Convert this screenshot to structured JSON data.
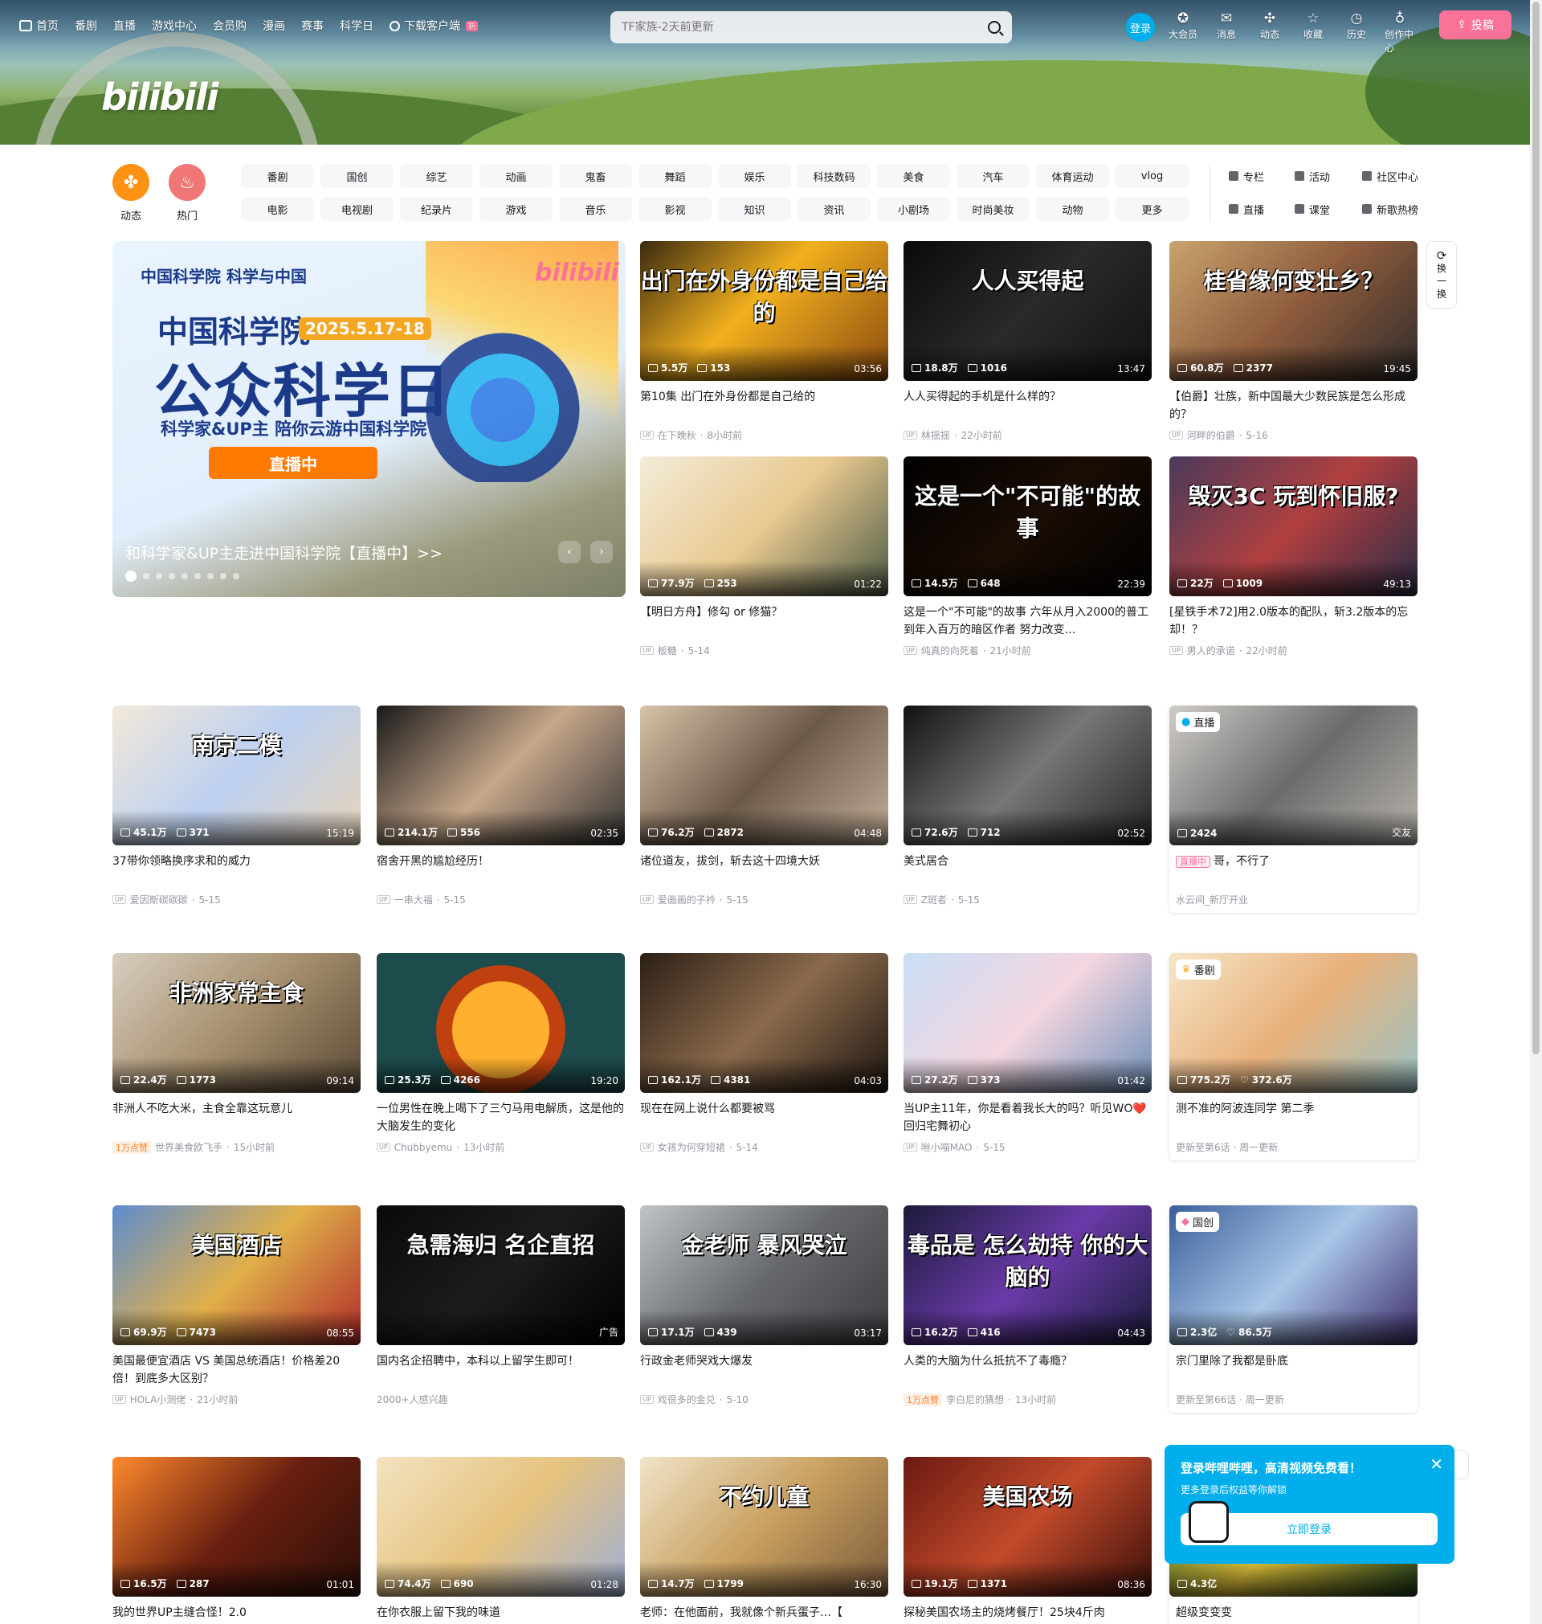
{
  "header": {
    "nav": [
      "首页",
      "番剧",
      "直播",
      "游戏中心",
      "会员购",
      "漫画",
      "赛事",
      "科学日"
    ],
    "download": "下载客户端",
    "download_badge": "新",
    "search_placeholder": "TF家族-2天前更新",
    "login": "登录",
    "right_nav": [
      {
        "label": "大会员",
        "icon": "vip-icon"
      },
      {
        "label": "消息",
        "icon": "message-icon"
      },
      {
        "label": "动态",
        "icon": "dynamic-icon"
      },
      {
        "label": "收藏",
        "icon": "star-icon"
      },
      {
        "label": "历史",
        "icon": "clock-icon"
      },
      {
        "label": "创作中心",
        "icon": "bulb-icon"
      }
    ],
    "upload": "投稿",
    "logo": "bilibili"
  },
  "channels": {
    "left": [
      {
        "label": "动态",
        "color": "#ff9212"
      },
      {
        "label": "热门",
        "color": "#f07775"
      }
    ],
    "grid": [
      "番剧",
      "国创",
      "综艺",
      "动画",
      "鬼畜",
      "舞蹈",
      "娱乐",
      "科技数码",
      "美食",
      "汽车",
      "体育运动",
      "vlog",
      "电影",
      "电视剧",
      "纪录片",
      "游戏",
      "音乐",
      "影视",
      "知识",
      "资讯",
      "小剧场",
      "时尚美妆",
      "动物",
      "更多"
    ],
    "extra": [
      "专栏",
      "活动",
      "社区中心",
      "直播",
      "课堂",
      "新歌热榜"
    ]
  },
  "hero": {
    "org": "中国科学院  科学与中国",
    "logo": "bilibili",
    "headline": "中国科学院",
    "date": "2025.5.17-18",
    "main": "公众科学日",
    "sub": "科学家&UP主   陪你云游中国科学院",
    "live": "直播中",
    "caption": "和科学家&UP主走进中国科学院【直播中】>>"
  },
  "refresh": [
    "换",
    "一",
    "换"
  ],
  "videos": [
    {
      "title": "第10集 出门在外身份都是自己给的",
      "views": "5.5万",
      "danmaku": "153",
      "duration": "03:56",
      "author": "在下晚秋",
      "time": "8小时前",
      "thumb_text": "出门在外身份都是自己给的",
      "bg": "linear-gradient(135deg,#3a2a10,#f2b01e 45%,#8a4a10)"
    },
    {
      "title": "人人买得起的手机是什么样的？",
      "views": "18.8万",
      "danmaku": "1016",
      "duration": "13:47",
      "author": "林揺揺",
      "time": "22小时前",
      "thumb_text": "人人买得起",
      "bg": "linear-gradient(135deg,#0a0a0a,#2a2a2a 50%,#111)"
    },
    {
      "title": "【伯爵】壮族，新中国最大少数民族是怎么形成的？",
      "views": "60.8万",
      "danmaku": "2377",
      "duration": "19:45",
      "author": "河畔的伯爵",
      "time": "5-16",
      "thumb_text": "桂省缘何变壮乡？",
      "bg": "linear-gradient(135deg,#c9a36d,#8d5b3c 50%,#2e2a2a)"
    },
    {
      "title": "【明日方舟】修勾 or 修猫？",
      "views": "77.9万",
      "danmaku": "253",
      "duration": "01:22",
      "author": "板糖",
      "time": "5-14",
      "thumb_text": "",
      "bg": "linear-gradient(135deg,#f3ecd9,#e8c98f 50%,#4b5a45)"
    },
    {
      "title": "这是一个\"不可能\"的故事 六年从月入2000的普工到年入百万的暗区作者 努力改变…",
      "views": "14.5万",
      "danmaku": "648",
      "duration": "22:39",
      "author": "纯真的向死着",
      "time": "21小时前",
      "thumb_text": "这是一个\"不可能\"的故事",
      "bg": "linear-gradient(135deg,#000,#1a0d05 50%,#000)"
    },
    {
      "title": "[星铁手术72]用2.0版本的配队，斩3.2版本的忘却！？",
      "views": "22万",
      "danmaku": "1009",
      "duration": "49:13",
      "author": "男人的承诺",
      "time": "22小时前",
      "thumb_text": "毁灭3C 玩到怀旧服?",
      "bg": "linear-gradient(135deg,#4a3a5a,#b04040 50%,#2b2b45)"
    },
    {
      "title": "37带你领略换序求和的威力",
      "views": "45.1万",
      "danmaku": "371",
      "duration": "15:19",
      "author": "爱因斯碳碳碳",
      "time": "5-15",
      "thumb_text": "南京二模",
      "bg": "linear-gradient(135deg,#f3e9da,#bcd0f0 50%,#e8d4b8)"
    },
    {
      "title": "宿舍开黑的尴尬经历！",
      "views": "214.1万",
      "danmaku": "556",
      "duration": "02:35",
      "author": "一串大福",
      "time": "5-15",
      "thumb_text": "",
      "bg": "linear-gradient(135deg,#1a1a1a,#c6a78a 50%,#333)"
    },
    {
      "title": "诸位道友，拔剑，斩去这十四境大妖",
      "views": "76.2万",
      "danmaku": "2872",
      "duration": "04:48",
      "author": "爱画画的子衿",
      "time": "5-15",
      "thumb_text": "",
      "bg": "linear-gradient(135deg,#d9c3a9,#6c5a48 50%,#c4b09a)"
    },
    {
      "title": "美式居合",
      "views": "72.6万",
      "danmaku": "712",
      "duration": "02:52",
      "author": "Z斑者",
      "time": "5-15",
      "thumb_text": "",
      "bg": "linear-gradient(135deg,#111,#777 50%,#222)"
    },
    {
      "title": "非洲人不吃大米，主食全靠这玩意儿",
      "views": "22.4万",
      "danmaku": "1773",
      "duration": "09:14",
      "author": "世界美食欧飞手",
      "time": "15小时前",
      "likes": "1万点赞",
      "thumb_text": "非洲家常主食",
      "bg": "linear-gradient(135deg,#d8cfc0,#a68f6e 50%,#5a4a36)"
    },
    {
      "title": "一位男性在晚上喝下了三勺马用电解质，这是他的大脑发生的变化",
      "views": "25.3万",
      "danmaku": "4266",
      "duration": "19:20",
      "author": "Chubbyemu",
      "time": "13小时前",
      "thumb_text": "",
      "bg": "radial-gradient(circle at 50% 55%,#ffb02e 0 60px,#c0410f 61px 80px,#1e4b4b 81px)"
    },
    {
      "title": "现在在网上说什么都要被骂",
      "views": "162.1万",
      "danmaku": "4381",
      "duration": "04:03",
      "author": "女孩为何穿短裙",
      "time": "5-14",
      "thumb_text": "",
      "bg": "linear-gradient(135deg,#2c1f15,#8a6a4c 50%,#1e1610)"
    },
    {
      "title": "当UP主11年，你是看着我长大的吗？听见WO❤️回归宅舞初心",
      "views": "27.2万",
      "danmaku": "373",
      "duration": "01:42",
      "author": "咝小喵MAO",
      "time": "5-15",
      "thumb_text": "",
      "bg": "linear-gradient(135deg,#c9def5,#f3d6e0 50%,#6e8fb8)"
    },
    {
      "title": "美国最便宜酒店 VS 美国总统酒店！价格差20倍！到底多大区别？",
      "views": "69.9万",
      "danmaku": "7473",
      "duration": "08:55",
      "author": "HOLA小测佬",
      "time": "21小时前",
      "thumb_text": "美国酒店",
      "bg": "linear-gradient(135deg,#5e8ccf,#e0b04a 50%,#b02a2a)"
    },
    {
      "title": "国内名企招聘中，本科以上留学生即可！",
      "views": "",
      "danmaku": "",
      "duration": "广告",
      "author": "2000+人感兴趣",
      "time": "",
      "ad": true,
      "thumb_text": "急需海归 名企直招",
      "bg": "linear-gradient(135deg,#0a0a0a,#1c1c1c 50%,#000)"
    },
    {
      "title": "行政金老师哭戏大爆发",
      "views": "17.1万",
      "danmaku": "439",
      "duration": "03:17",
      "author": "戏很多的金兑",
      "time": "5-10",
      "thumb_text": "金老师 暴风哭泣",
      "bg": "linear-gradient(135deg,#bfc4c6,#676a6e 50%,#3b3d40)"
    },
    {
      "title": "人类的大脑为什么抵抗不了毒瘾？",
      "views": "16.2万",
      "danmaku": "416",
      "duration": "04:43",
      "author": "李白尼的猜想",
      "time": "13小时前",
      "likes": "1万点赞",
      "thumb_text": "毒品是 怎么劫持 你的大脑的",
      "bg": "linear-gradient(135deg,#1b1b3a,#6a3aa8 50%,#1b1b3a)"
    },
    {
      "title": "我的世界UP主缝合怪！2.0",
      "views": "16.5万",
      "danmaku": "287",
      "duration": "01:01",
      "author": "",
      "time": "",
      "thumb_text": "",
      "bg": "linear-gradient(135deg,#ff8a2e,#6a1f10 50%,#2b0f08)"
    },
    {
      "title": "在你衣服上留下我的味道",
      "views": "74.4万",
      "danmaku": "690",
      "duration": "01:28",
      "author": "",
      "time": "",
      "thumb_text": "",
      "bg": "linear-gradient(135deg,#f3e3c0,#e6c27e 50%,#9fb0d6)"
    },
    {
      "title": "老师：在他面前，我就像个新兵蛋子…【",
      "views": "14.7万",
      "danmaku": "1799",
      "duration": "16:30",
      "author": "",
      "time": "",
      "thumb_text": "不约儿童",
      "bg": "linear-gradient(135deg,#f0e4c8,#c9a060 50%,#7a5a3a)"
    },
    {
      "title": "探秘美国农场主的烧烤餐厅！25块4斤肉",
      "views": "19.1万",
      "danmaku": "1371",
      "duration": "08:36",
      "author": "",
      "time": "",
      "thumb_text": "美国农场",
      "bg": "linear-gradient(135deg,#6b1a12,#c24a2a 50%,#3a0f0a)"
    }
  ],
  "special_cards": [
    {
      "tag": "直播",
      "title": "哥，不行了",
      "viewers": "2424",
      "category": "交友",
      "live_label": "直播中",
      "meta": "水云间_新厅开业",
      "bg": "linear-gradient(135deg,#d0cdc8,#6b6b6b 50%,#b8b4ac)"
    },
    {
      "tag": "番剧",
      "title": "测不准的阿波连同学 第二季",
      "views": "775.2万",
      "follows": "372.6万",
      "meta": "更新至第6话 · 周一更新",
      "bg": "linear-gradient(135deg,#f6e6c8,#e8b07a 50%,#9ac4c8)"
    },
    {
      "tag": "国创",
      "title": "宗门里除了我都是卧底",
      "views": "2.3亿",
      "follows": "86.5万",
      "meta": "更新至第66话 · 周一更新",
      "bg": "linear-gradient(135deg,#3a5f9a,#a9c6e8 50%,#3b2c6a)"
    },
    {
      "tag": "",
      "title": "超级变变变",
      "views": "4.3亿",
      "bg": "linear-gradient(135deg,#1f5a2a,#e2c23a 50%,#1a3a1a)"
    }
  ],
  "login_popup": {
    "title": "登录哔哩哔哩，高清视频免费看！",
    "subtitle": "更多登录后权益等你解锁",
    "button": "立即登录"
  }
}
